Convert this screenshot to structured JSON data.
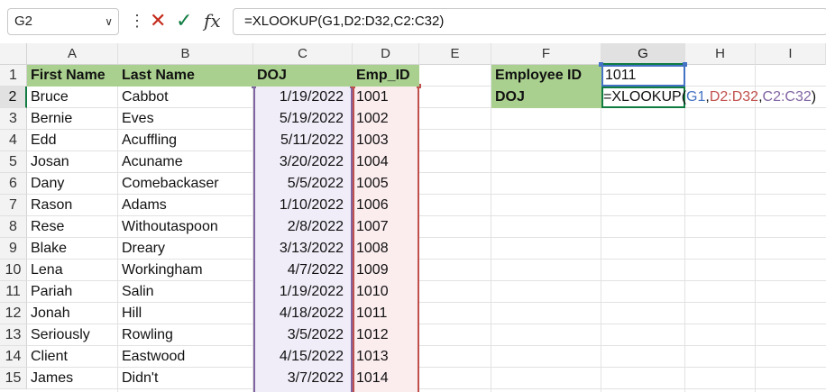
{
  "formula_bar": {
    "name_box": "G2",
    "formula": "=XLOOKUP(G1,D2:D32,C2:C32)",
    "fx_label": "fx"
  },
  "columns": [
    "A",
    "B",
    "C",
    "D",
    "E",
    "F",
    "G",
    "H",
    "I"
  ],
  "rows": [
    "1",
    "2",
    "3",
    "4",
    "5",
    "6",
    "7",
    "8",
    "9",
    "10",
    "11",
    "12",
    "13",
    "14",
    "15"
  ],
  "headers": {
    "first_name": "First Name",
    "last_name": "Last Name",
    "doj": "DOJ",
    "emp_id": "Emp_ID"
  },
  "employees": [
    {
      "first": "Bruce",
      "last": "Cabbot",
      "doj": "1/19/2022",
      "id": "1001"
    },
    {
      "first": "Bernie",
      "last": "Eves",
      "doj": "5/19/2022",
      "id": "1002"
    },
    {
      "first": "Edd",
      "last": "Acuffling",
      "doj": "5/11/2022",
      "id": "1003"
    },
    {
      "first": "Josan",
      "last": "Acuname",
      "doj": "3/20/2022",
      "id": "1004"
    },
    {
      "first": "Dany",
      "last": "Comebackaser",
      "doj": "5/5/2022",
      "id": "1005"
    },
    {
      "first": "Rason",
      "last": "Adams",
      "doj": "1/10/2022",
      "id": "1006"
    },
    {
      "first": "Rese",
      "last": "Withoutaspoon",
      "doj": "2/8/2022",
      "id": "1007"
    },
    {
      "first": "Blake",
      "last": "Dreary",
      "doj": "3/13/2022",
      "id": "1008"
    },
    {
      "first": "Lena",
      "last": "Workingham",
      "doj": "4/7/2022",
      "id": "1009"
    },
    {
      "first": "Pariah",
      "last": "Salin",
      "doj": "1/19/2022",
      "id": "1010"
    },
    {
      "first": "Jonah",
      "last": "Hill",
      "doj": "4/18/2022",
      "id": "1011"
    },
    {
      "first": "Seriously",
      "last": "Rowling",
      "doj": "3/5/2022",
      "id": "1012"
    },
    {
      "first": "Client",
      "last": "Eastwood",
      "doj": "4/15/2022",
      "id": "1013"
    },
    {
      "first": "James",
      "last": "Didn't",
      "doj": "3/7/2022",
      "id": "1014"
    }
  ],
  "lookup": {
    "employee_id_label": "Employee ID",
    "employee_id_value": "1011",
    "doj_label": "DOJ",
    "formula_parts": {
      "prefix": "=XLOOKUP(",
      "arg1": "G1",
      "sep1": ",",
      "arg2": "D2:D32",
      "sep2": ",",
      "arg3": "C2:C32",
      "suffix": ")"
    }
  },
  "colors": {
    "header_green": "#a9d08e",
    "selection_green": "#107c41",
    "ref_blue": "#4472c4",
    "ref_red": "#c0504d",
    "ref_purple": "#8064a2"
  },
  "icons": [
    "chevron-down-icon",
    "more-vertical-icon",
    "cancel-icon",
    "enter-check-icon",
    "function-icon"
  ]
}
